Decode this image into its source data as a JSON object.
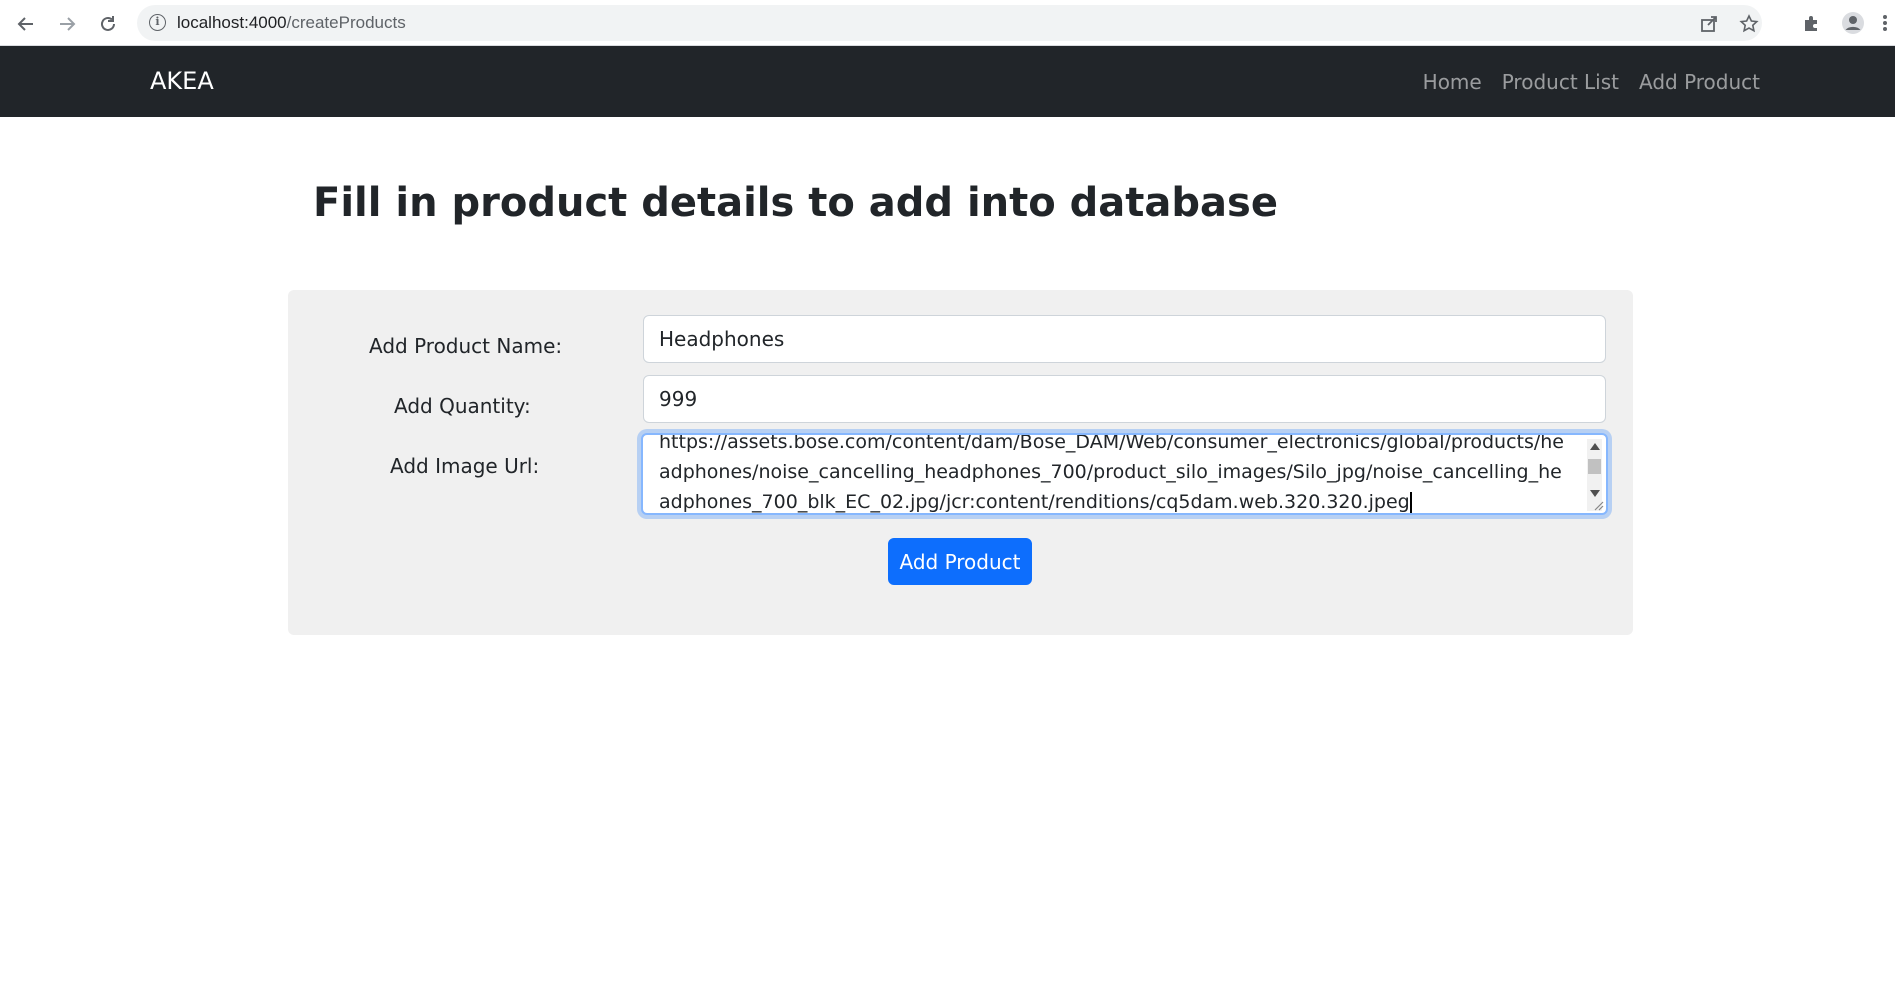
{
  "browser": {
    "url_host": "localhost:4000",
    "url_path": "/createProducts"
  },
  "navbar": {
    "brand": "AKEA",
    "links": [
      "Home",
      "Product List",
      "Add Product"
    ]
  },
  "page": {
    "title": "Fill in product details to add into database"
  },
  "form": {
    "name_label": "Add Product Name:",
    "name_value": "Headphones",
    "quantity_label": "Add Quantity:",
    "quantity_value": "999",
    "image_label": "Add Image Url:",
    "image_value": "https://assets.bose.com/content/dam/Bose_DAM/Web/consumer_electronics/global/products/headphones/noise_cancelling_headphones_700/product_silo_images/Silo_jpg/noise_cancelling_headphones_700_blk_EC_02.jpg/jcr:content/renditions/cq5dam.web.320.320.jpeg",
    "submit_label": "Add Product"
  },
  "icons": {
    "back": "arrow-left-icon",
    "forward": "arrow-right-icon",
    "reload": "reload-icon",
    "site_info": "info-icon",
    "share": "share-icon",
    "bookmark": "star-icon",
    "extensions": "puzzle-icon",
    "profile": "avatar-icon",
    "menu": "kebab-menu-icon"
  },
  "colors": {
    "navbar_bg": "#212529",
    "primary": "#0d6efd",
    "panel_bg": "#f0f0f0"
  }
}
